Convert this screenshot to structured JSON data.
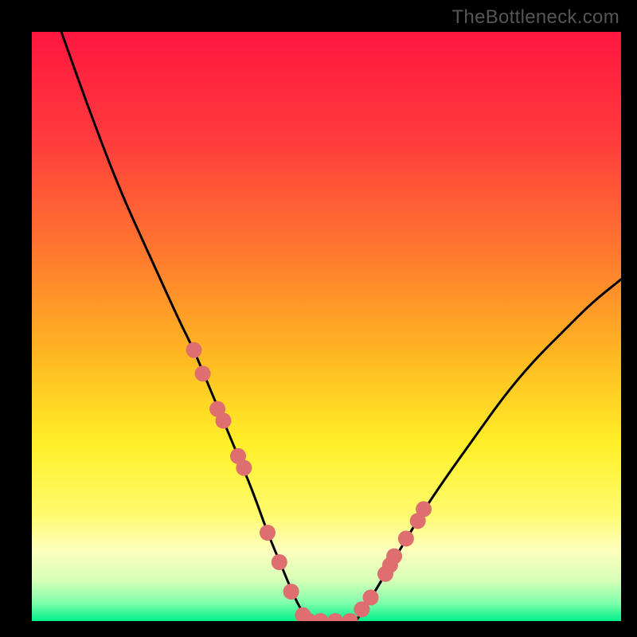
{
  "watermark": "TheBottleneck.com",
  "chart_data": {
    "type": "line",
    "title": "",
    "xlabel": "",
    "ylabel": "",
    "xlim": [
      0,
      100
    ],
    "ylim": [
      0,
      100
    ],
    "curve_left": {
      "x": [
        5,
        10,
        15,
        20,
        25,
        27.5,
        30,
        32.5,
        35,
        37.5,
        40,
        42.5,
        45,
        47
      ],
      "y": [
        100,
        86,
        73,
        62,
        51,
        46,
        40,
        34,
        28,
        22,
        15,
        9,
        3,
        0
      ]
    },
    "curve_right": {
      "x": [
        55,
        57,
        60,
        63,
        66,
        70,
        75,
        80,
        85,
        90,
        95,
        100
      ],
      "y": [
        0,
        3,
        8,
        13,
        18,
        24,
        31,
        38,
        44,
        49,
        54,
        58
      ]
    },
    "flat_bottom": {
      "x": [
        47,
        55
      ],
      "y": [
        0,
        0
      ]
    },
    "markers_left": {
      "x": [
        27.5,
        29,
        31.5,
        32.5,
        35,
        36,
        40,
        42,
        44,
        46
      ],
      "y": [
        46,
        42,
        36,
        34,
        28,
        26,
        15,
        10,
        5,
        1
      ]
    },
    "markers_bottom": {
      "x": [
        47,
        49,
        51.5,
        54
      ],
      "y": [
        0,
        0,
        0,
        0
      ]
    },
    "markers_right": {
      "x": [
        56,
        57.5,
        60,
        60.8,
        61.5,
        63.5,
        65.5,
        66.5
      ],
      "y": [
        2,
        4,
        8,
        9.5,
        11,
        14,
        17,
        19
      ]
    },
    "gradient_stops": [
      {
        "offset": 0.0,
        "color": "#ff163f"
      },
      {
        "offset": 0.18,
        "color": "#ff3b3d"
      },
      {
        "offset": 0.38,
        "color": "#ff7a2e"
      },
      {
        "offset": 0.55,
        "color": "#ffb822"
      },
      {
        "offset": 0.7,
        "color": "#fff029"
      },
      {
        "offset": 0.82,
        "color": "#fffb6f"
      },
      {
        "offset": 0.88,
        "color": "#fdffbe"
      },
      {
        "offset": 0.93,
        "color": "#d8ffb8"
      },
      {
        "offset": 0.97,
        "color": "#7dffab"
      },
      {
        "offset": 1.0,
        "color": "#00ef89"
      }
    ],
    "marker_color": "#de6e6f",
    "curve_color": "#000000"
  }
}
